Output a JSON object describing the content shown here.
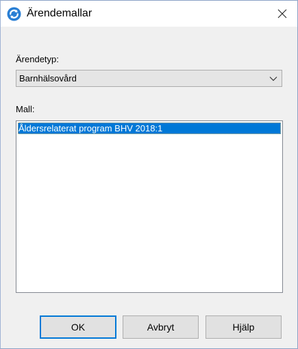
{
  "window": {
    "title": "Ärendemallar",
    "icon": "refresh-circle-icon",
    "close_icon": "close-icon"
  },
  "case_type": {
    "label": "Ärendetyp:",
    "selected": "Barnhälsovård"
  },
  "template": {
    "label": "Mall:",
    "items": [
      {
        "text": "Åldersrelaterat program BHV 2018:1",
        "selected": true
      }
    ]
  },
  "buttons": {
    "ok": "OK",
    "cancel": "Avbryt",
    "help": "Hjälp"
  },
  "colors": {
    "accent": "#0078d7",
    "app_icon": "#2a7fd4"
  }
}
